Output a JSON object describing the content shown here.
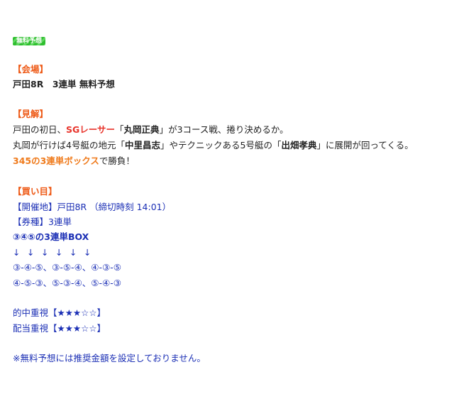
{
  "badge": "無料予想",
  "venue": {
    "heading": "【会場】",
    "text": "戸田8R　3連単 無料予想"
  },
  "view": {
    "heading": "【見解】",
    "line1": {
      "a": "戸田の初日、",
      "b": "SGレーサー",
      "c": "「",
      "d": "丸岡正典",
      "e": "」が3コース戦、捲り決めるか。"
    },
    "line2": {
      "a": "丸岡が行けば4号艇の地元「",
      "b": "中里昌志",
      "c": "」やテクニックある5号艇の「",
      "d": "出畑孝典",
      "e": "」に展開が回ってくる。"
    },
    "line3": {
      "a": "345の3連単ボックス",
      "b": "で勝負！"
    }
  },
  "picks": {
    "heading": "【買い目】",
    "place": "【開催地】戸田8R （締切時刻 14:01）",
    "ticket": "【券種】3連単",
    "box": "③④⑤の3連単BOX",
    "arrows": [
      "↓",
      "↓",
      "↓",
      "↓",
      "↓",
      "↓"
    ],
    "combos1": "③-④-⑤、③-⑤-④、④-③-⑤",
    "combos2": "④-⑤-③、⑤-③-④、⑤-④-③"
  },
  "ratings": {
    "hit": "的中重視【★★★☆☆】",
    "payout": "配当重視【★★★☆☆】"
  },
  "note": "※無料予想には推奨金額を設定しておりません。"
}
